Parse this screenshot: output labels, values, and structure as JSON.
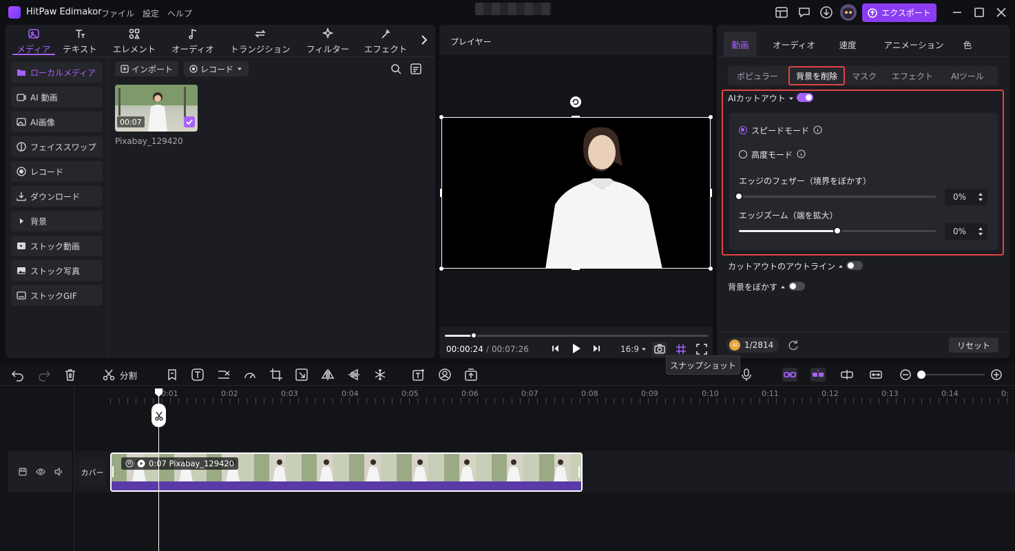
{
  "app": {
    "name": "HitPaw Edimakor",
    "menu": [
      "ファイル",
      "設定",
      "ヘルプ"
    ],
    "export_label": "エクスポート"
  },
  "left": {
    "tabs": [
      {
        "label": "メディア",
        "icon": "media-icon"
      },
      {
        "label": "テキスト",
        "icon": "text-icon"
      },
      {
        "label": "エレメント",
        "icon": "elements-icon"
      },
      {
        "label": "オーディオ",
        "icon": "audio-icon"
      },
      {
        "label": "トランジション",
        "icon": "transition-icon"
      },
      {
        "label": "フィルター",
        "icon": "filter-icon"
      },
      {
        "label": "エフェクト",
        "icon": "effect-icon"
      }
    ],
    "sidebar": [
      {
        "label": "ローカルメディア",
        "icon": "folder-icon"
      },
      {
        "label": "AI 動画",
        "icon": "ai-video-icon"
      },
      {
        "label": "AI画像",
        "icon": "ai-image-icon"
      },
      {
        "label": "フェイススワップ",
        "icon": "face-swap-icon"
      },
      {
        "label": "レコード",
        "icon": "record-icon"
      },
      {
        "label": "ダウンロード",
        "icon": "download-icon"
      },
      {
        "label": "背景",
        "icon": "caret-right-icon"
      },
      {
        "label": "ストック動画",
        "icon": "stock-video-icon"
      },
      {
        "label": "ストック写真",
        "icon": "stock-photo-icon"
      },
      {
        "label": "ストックGIF",
        "icon": "gif-icon"
      }
    ],
    "import_label": "インポート",
    "record_label": "レコード",
    "media_item": {
      "duration": "00:07",
      "name": "Pixabay_129420"
    }
  },
  "player": {
    "title": "プレイヤー",
    "current_time": "00:00:24",
    "separator": "/",
    "total_time": "00:07:26",
    "aspect": "16:9",
    "progress": 0.11
  },
  "props": {
    "tabs": [
      "動画",
      "オーディオ",
      "速度",
      "アニメーション",
      "色"
    ],
    "subtabs": [
      "ポピュラー",
      "背景を削除",
      "マスク",
      "エフェクト",
      "AIツール"
    ],
    "ai_cutout_label": "AIカットアウト",
    "speed_mode": "スピードモード",
    "high_mode": "高度モード",
    "feather_label": "エッジのフェザー（境界をぼかす）",
    "feather_value": "0%",
    "feather_level": 0.0,
    "zoom_label": "エッジズーム（端を拡大）",
    "zoom_value": "0%",
    "zoom_level": 0.5,
    "outline_label": "カットアウトのアウトライン",
    "blur_bg_label": "背景をぼかす",
    "credits": "1/2814",
    "credits_badge": "AI",
    "reset_label": "リセット"
  },
  "timeline": {
    "split_label": "分割",
    "tooltip": "スナップショット",
    "ruler": [
      "0:01",
      "0:02",
      "0:03",
      "0:04",
      "0:05",
      "0:06",
      "0:07",
      "0:08",
      "0:09",
      "0:10",
      "0:11",
      "0:12",
      "0:13",
      "0:14",
      "0:"
    ],
    "cover_label": "カバー",
    "clip_label": "0:07 Pixabay_129420"
  },
  "colors": {
    "accent": "#a862ff",
    "export": "#8b3df2",
    "highlight": "#e04444"
  }
}
